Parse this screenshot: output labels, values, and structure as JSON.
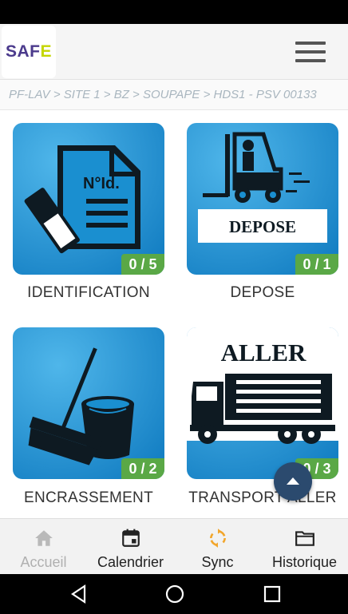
{
  "header": {
    "logo_main": "SAF",
    "logo_accent": "E",
    "menu_icon": "hamburger-menu-icon"
  },
  "breadcrumb": "PF-LAV > SITE 1 > BZ > SOUPAPE > HDS1 - PSV 00133",
  "tiles": [
    {
      "label": "IDENTIFICATION",
      "count": "0 / 5",
      "image_text": "N°Id.",
      "icon": "document-id-icon"
    },
    {
      "label": "DEPOSE",
      "count": "0 / 1",
      "image_text": "DEPOSE",
      "icon": "forklift-icon"
    },
    {
      "label": "ENCRASSEMENT",
      "count": "0 / 2",
      "image_text": "",
      "icon": "broom-bucket-icon"
    },
    {
      "label": "TRANSPORT ALLER",
      "count": "0 / 3",
      "image_text": "ALLER",
      "icon": "truck-icon"
    }
  ],
  "fab": {
    "icon": "arrow-up-icon"
  },
  "bottom_nav": [
    {
      "label": "Accueil",
      "icon": "home-icon",
      "active": false
    },
    {
      "label": "Calendrier",
      "icon": "calendar-icon",
      "active": true
    },
    {
      "label": "Sync",
      "icon": "sync-icon",
      "active": true
    },
    {
      "label": "Historique",
      "icon": "folder-icon",
      "active": true
    }
  ],
  "colors": {
    "tile_blue": "#1e8fd2",
    "badge_green": "#5aa846",
    "fab_navy": "#2b4a6e",
    "sync_orange": "#f2a62c",
    "logo_purple": "#4b3a8c",
    "logo_lime": "#c4d600"
  }
}
